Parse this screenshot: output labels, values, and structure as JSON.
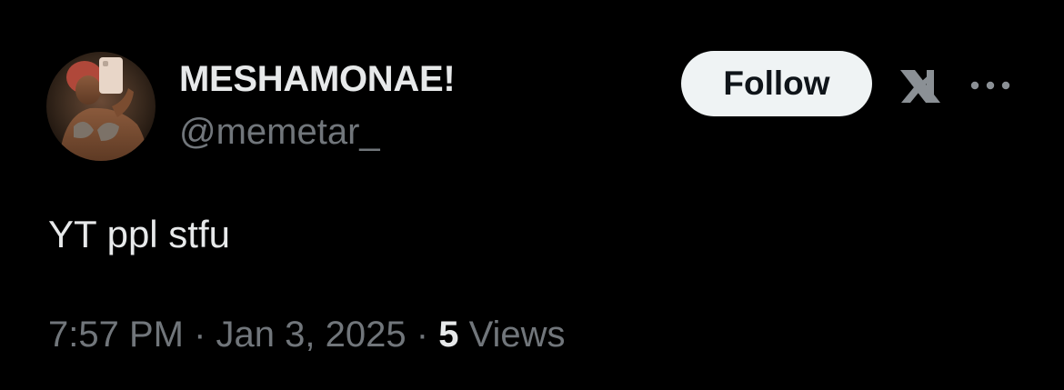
{
  "author": {
    "display_name": "MESHAMONAE!",
    "handle": "@memetar_",
    "avatar_icon": "profile-photo"
  },
  "actions": {
    "follow_label": "Follow",
    "grok_icon": "grok-icon",
    "more_icon": "more-horizontal-icon"
  },
  "tweet": {
    "text": "YT ppl stfu",
    "time": "7:57 PM",
    "separator": "·",
    "date": "Jan 3, 2025",
    "views_count": "5",
    "views_label": "Views"
  },
  "colors": {
    "background": "#000000",
    "primary_text": "#e7e9ea",
    "secondary_text": "#71767b",
    "follow_bg": "#eff3f4",
    "follow_text": "#0f1419"
  }
}
